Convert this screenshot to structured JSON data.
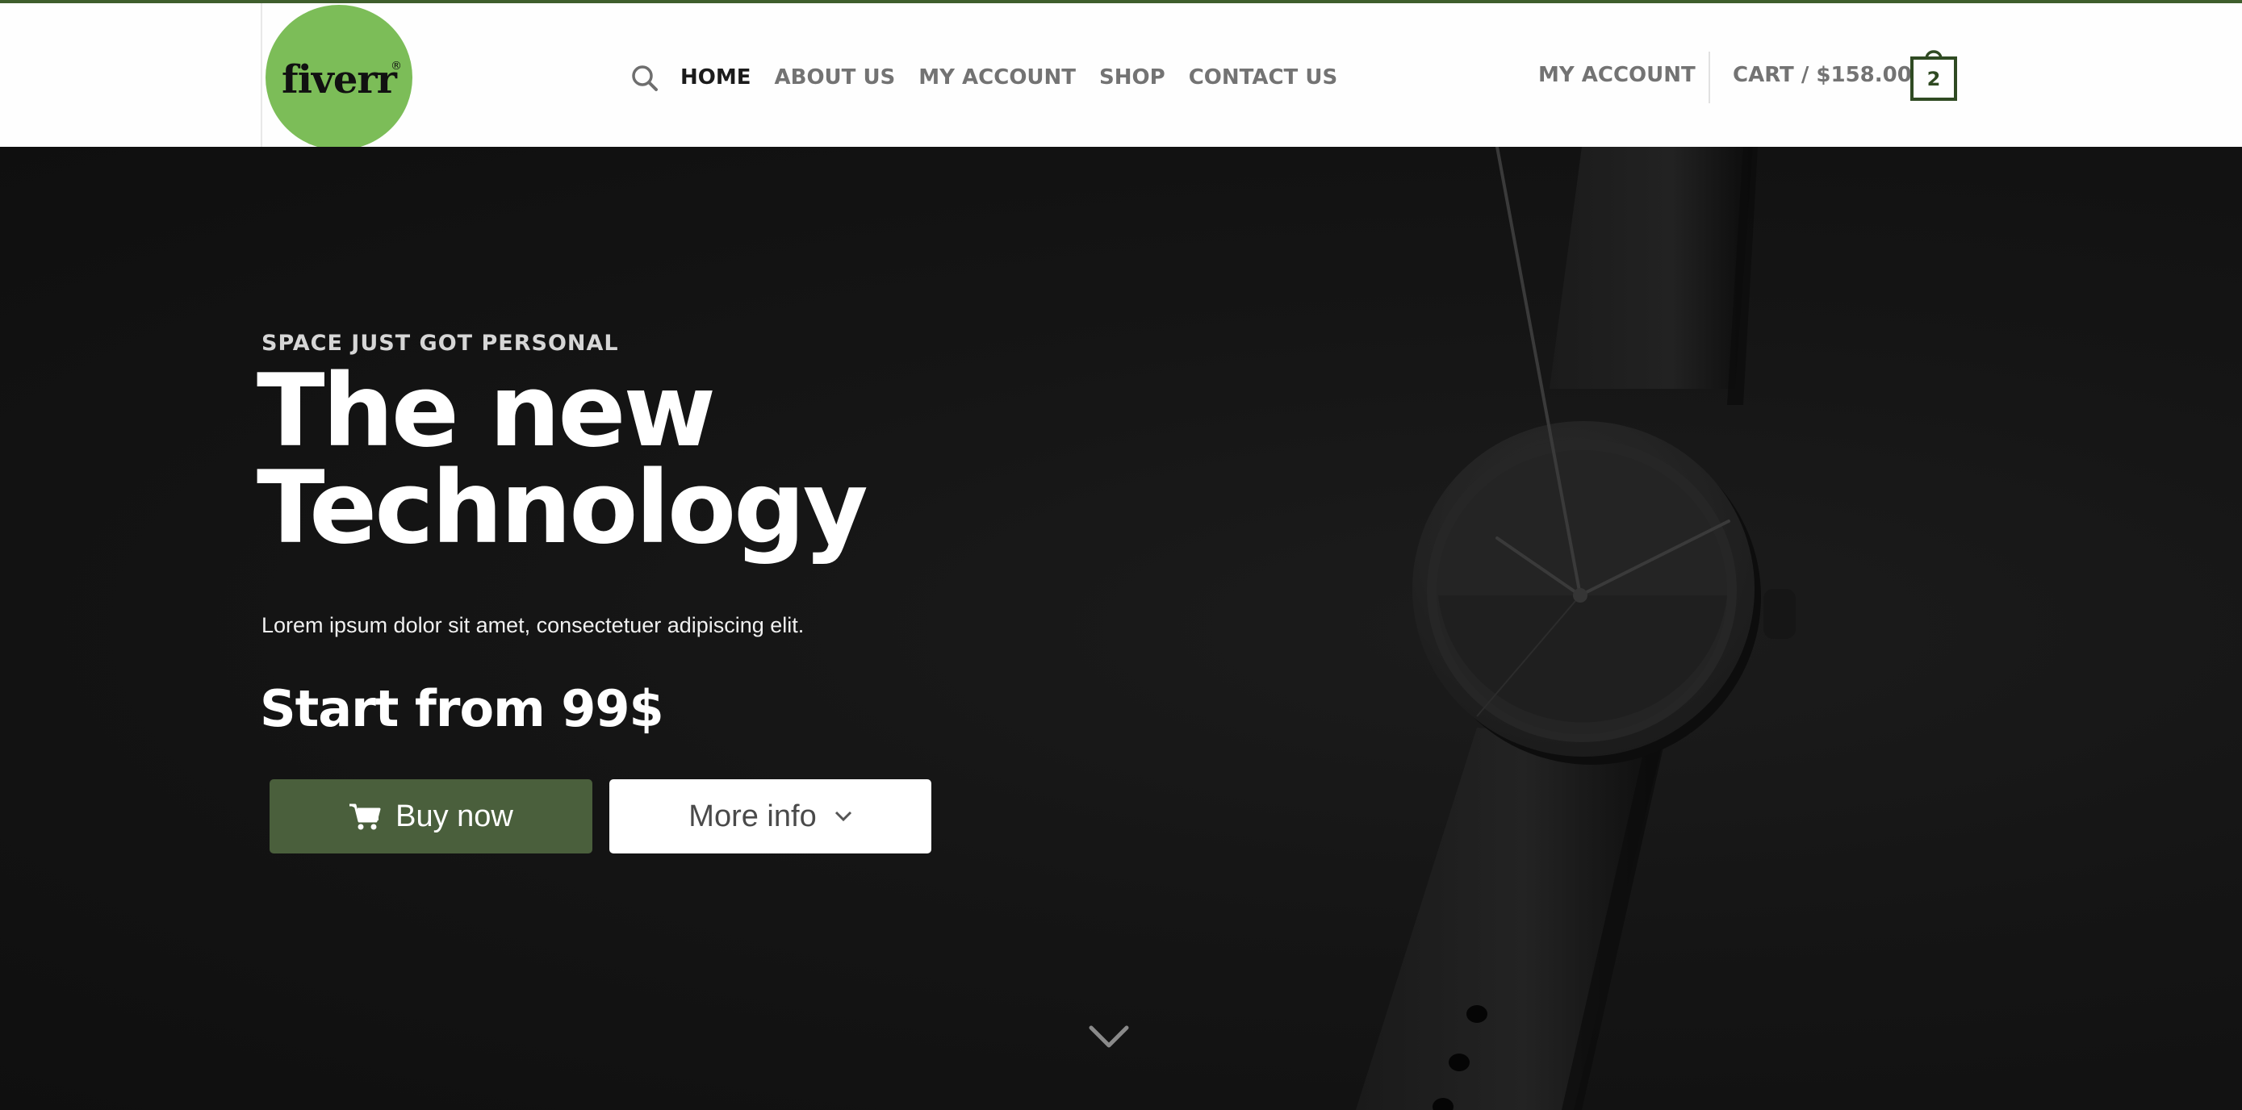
{
  "header": {
    "logo_text": "fiverr",
    "logo_mark": "®",
    "search_icon": "search-icon",
    "nav": [
      {
        "label": "HOME"
      },
      {
        "label": "ABOUT US"
      },
      {
        "label": "MY ACCOUNT"
      },
      {
        "label": "SHOP"
      },
      {
        "label": "CONTACT US"
      }
    ],
    "active_nav": "HOME",
    "account_label": "MY ACCOUNT",
    "cart_label": "CART / $158.00",
    "cart_count": "2",
    "colors": {
      "accent": "#3f5e2d",
      "logo_bg": "#7cbd58"
    }
  },
  "hero": {
    "kicker": "SPACE JUST GOT PERSONAL",
    "headline_line1": "The new",
    "headline_line2": "Technology",
    "subtext": "Lorem ipsum dolor sit amet, consectetuer adipiscing elit.",
    "price": "Start from 99$",
    "buy_label": "Buy now",
    "buy_icon": "cart-icon",
    "more_label": "More info",
    "more_icon": "chevron-down-icon",
    "scroll_icon": "chevron-down-icon",
    "colors": {
      "buy_button": "#4a5f3c",
      "background": "#151515"
    }
  }
}
